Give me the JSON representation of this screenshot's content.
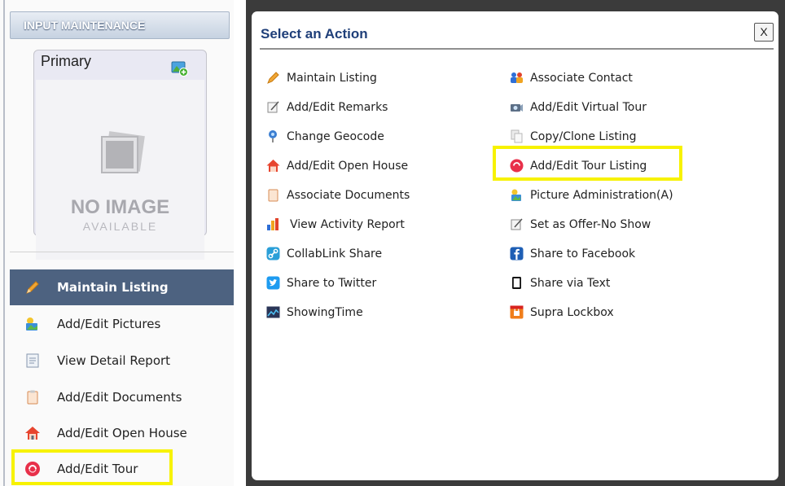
{
  "left_panel": {
    "header": "INPUT MAINTENANCE",
    "photo_card": {
      "label": "Primary",
      "no_image_line1": "NO IMAGE",
      "no_image_line2": "AVAILABLE"
    },
    "menu": [
      {
        "label": "Maintain Listing",
        "icon": "pencil-icon",
        "active": true
      },
      {
        "label": "Add/Edit Pictures",
        "icon": "picture-icon",
        "active": false
      },
      {
        "label": "View Detail Report",
        "icon": "report-icon",
        "active": false
      },
      {
        "label": "Add/Edit Documents",
        "icon": "clipboard-icon",
        "active": false
      },
      {
        "label": "Add/Edit Open House",
        "icon": "house-icon",
        "active": false
      },
      {
        "label": "Add/Edit Tour",
        "icon": "tour-icon",
        "active": false,
        "highlighted": true
      }
    ]
  },
  "dialog": {
    "title": "Select an Action",
    "close_label": "X",
    "left_actions": [
      {
        "label": "Maintain Listing",
        "icon": "pencil-icon"
      },
      {
        "label": "Add/Edit Remarks",
        "icon": "notepad-icon"
      },
      {
        "label": "Change Geocode",
        "icon": "globe-pin-icon"
      },
      {
        "label": "Add/Edit Open House",
        "icon": "house-icon"
      },
      {
        "label": "Associate Documents",
        "icon": "clipboard-icon"
      },
      {
        "label": "View Activity Report",
        "icon": "bar-chart-icon"
      },
      {
        "label": "CollabLink Share",
        "icon": "link-icon"
      },
      {
        "label": "Share to Twitter",
        "icon": "twitter-icon"
      },
      {
        "label": "ShowingTime",
        "icon": "showingtime-icon"
      }
    ],
    "right_actions": [
      {
        "label": "Associate Contact",
        "icon": "contacts-icon"
      },
      {
        "label": "Add/Edit Virtual Tour",
        "icon": "virtual-tour-icon"
      },
      {
        "label": "Copy/Clone Listing",
        "icon": "copy-icon"
      },
      {
        "label": "Add/Edit Tour Listing",
        "icon": "tour-icon",
        "highlighted": true
      },
      {
        "label": "Picture Administration(A)",
        "icon": "picture-icon"
      },
      {
        "label": "Set as Offer-No Show",
        "icon": "notepad-icon"
      },
      {
        "label": "Share to Facebook",
        "icon": "facebook-icon"
      },
      {
        "label": "Share via Text",
        "icon": "phone-icon"
      },
      {
        "label": "Supra Lockbox",
        "icon": "lockbox-icon"
      }
    ]
  },
  "colors": {
    "highlight": "#f7f200",
    "active_menu_bg": "#4d6280",
    "dialog_title": "#1f3f79",
    "backdrop": "#3b3b3b"
  }
}
